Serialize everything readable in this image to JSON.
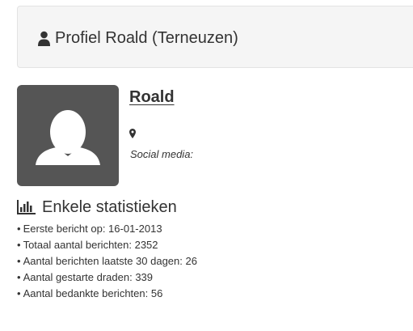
{
  "header": {
    "title": "Profiel Roald (Terneuzen)",
    "icon": "user-icon"
  },
  "profile": {
    "username": "Roald",
    "avatar_icon": "avatar-placeholder",
    "location_icon": "map-marker-icon",
    "social_media_label": "Social media:"
  },
  "stats": {
    "heading": "Enkele statistieken",
    "icon": "bar-chart-icon",
    "items": [
      "Eerste bericht op: 16-01-2013",
      "Totaal aantal berichten: 2352",
      "Aantal berichten laatste 30 dagen: 26",
      "Aantal gestarte draden: 339",
      "Aantal bedankte berichten: 56"
    ]
  },
  "colors": {
    "header_bg": "#f5f5f5",
    "header_border": "#e3e3e3",
    "avatar_bg": "#555555",
    "text": "#333333"
  }
}
